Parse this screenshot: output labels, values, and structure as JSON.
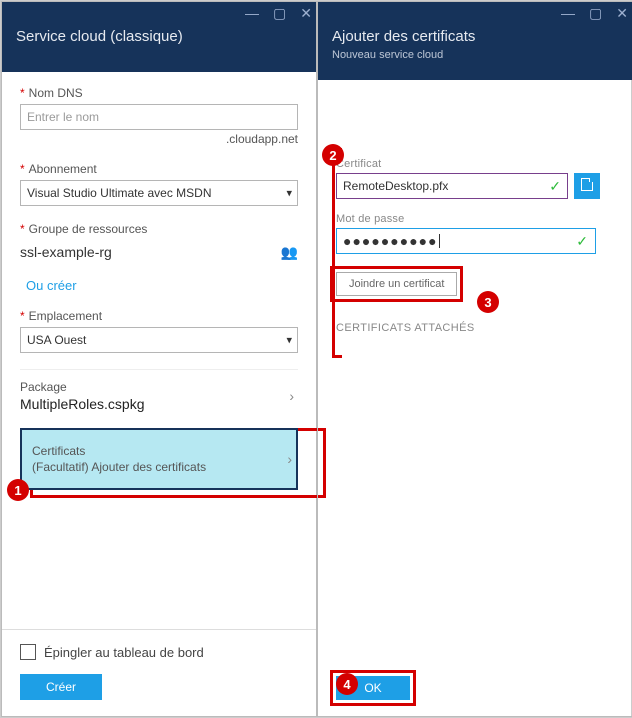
{
  "left": {
    "title": "Service cloud (classique)",
    "dns": {
      "label": "Nom DNS",
      "placeholder": "Entrer le nom",
      "suffix": ".cloudapp.net"
    },
    "subscription": {
      "label": "Abonnement",
      "value": "Visual Studio Ultimate avec MSDN"
    },
    "resource_group": {
      "label": "Groupe de ressources",
      "value": "ssl-example-rg",
      "create_link": "Ou créer"
    },
    "location": {
      "label": "Emplacement",
      "value": "USA Ouest"
    },
    "package": {
      "label": "Package",
      "value": "MultipleRoles.cspkg"
    },
    "certificates": {
      "label": "Certificats",
      "sub": "(Facultatif) Ajouter des certificats"
    },
    "pin_label": "Épingler au tableau de bord",
    "create_btn": "Créer"
  },
  "right": {
    "title": "Ajouter des certificats",
    "subtitle": "Nouveau service cloud",
    "cert": {
      "label": "Certificat",
      "value": "RemoteDesktop.pfx"
    },
    "password": {
      "label": "Mot de passe",
      "masked": "●●●●●●●●●●"
    },
    "attach_btn": "Joindre un certificat",
    "attached_heading": "CERTIFICATS ATTACHÉS",
    "ok_btn": "OK"
  },
  "callouts": {
    "c1": "1",
    "c2": "2",
    "c3": "3",
    "c4": "4"
  }
}
